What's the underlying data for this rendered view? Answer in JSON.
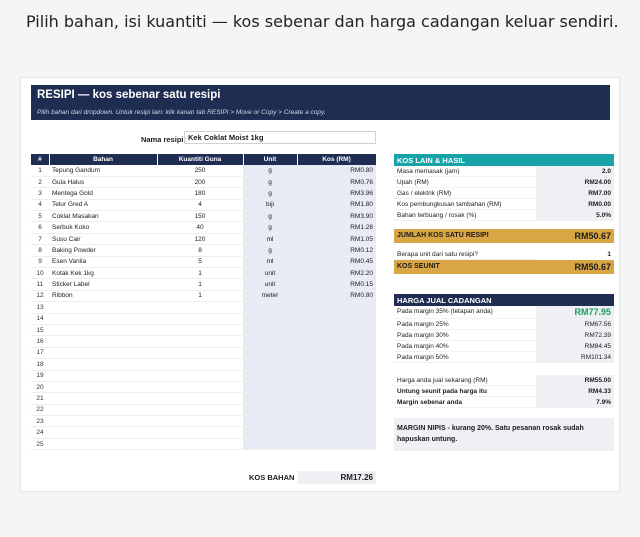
{
  "intro": "Pilih bahan, isi kuantiti — kos sebenar dan harga cadangan keluar sendiri.",
  "banner": {
    "title": "RESIPI — kos sebenar satu resipi",
    "subtitle": "Pilih bahan dari dropdown. Untuk resipi lain: klik kanan tab RESIPI > Move or Copy > Create a copy."
  },
  "recipe": {
    "name_label": "Nama resipi:",
    "name_value": "Kek Coklat Moist 1kg"
  },
  "grid": {
    "headers": [
      "#",
      "Bahan",
      "Kuantiti Guna",
      "Unit",
      "Kos (RM)"
    ],
    "rows": [
      {
        "n": "1",
        "bahan": "Tepung Gandum",
        "q": "250",
        "unit": "g",
        "kos": "RM0.80"
      },
      {
        "n": "2",
        "bahan": "Gula Halus",
        "q": "200",
        "unit": "g",
        "kos": "RM0.76"
      },
      {
        "n": "3",
        "bahan": "Mentega Gold",
        "q": "180",
        "unit": "g",
        "kos": "RM3.96"
      },
      {
        "n": "4",
        "bahan": "Telur Gred A",
        "q": "4",
        "unit": "biji",
        "kos": "RM1.80"
      },
      {
        "n": "5",
        "bahan": "Coklat Masakan",
        "q": "150",
        "unit": "g",
        "kos": "RM3.90"
      },
      {
        "n": "6",
        "bahan": "Serbuk Koko",
        "q": "40",
        "unit": "g",
        "kos": "RM1.28"
      },
      {
        "n": "7",
        "bahan": "Susu Cair",
        "q": "120",
        "unit": "ml",
        "kos": "RM1.05"
      },
      {
        "n": "8",
        "bahan": "Baking Powder",
        "q": "8",
        "unit": "g",
        "kos": "RM0.12"
      },
      {
        "n": "9",
        "bahan": "Esen Vanila",
        "q": "5",
        "unit": "ml",
        "kos": "RM0.45"
      },
      {
        "n": "10",
        "bahan": "Kotak Kek 1kg",
        "q": "1",
        "unit": "unit",
        "kos": "RM2.20"
      },
      {
        "n": "11",
        "bahan": "Sticker Label",
        "q": "1",
        "unit": "unit",
        "kos": "RM0.15"
      },
      {
        "n": "12",
        "bahan": "Ribbon",
        "q": "1",
        "unit": "meter",
        "kos": "RM0.80"
      },
      {
        "n": "13",
        "bahan": "",
        "q": "",
        "unit": "",
        "kos": ""
      },
      {
        "n": "14",
        "bahan": "",
        "q": "",
        "unit": "",
        "kos": ""
      },
      {
        "n": "15",
        "bahan": "",
        "q": "",
        "unit": "",
        "kos": ""
      },
      {
        "n": "16",
        "bahan": "",
        "q": "",
        "unit": "",
        "kos": ""
      },
      {
        "n": "17",
        "bahan": "",
        "q": "",
        "unit": "",
        "kos": ""
      },
      {
        "n": "18",
        "bahan": "",
        "q": "",
        "unit": "",
        "kos": ""
      },
      {
        "n": "19",
        "bahan": "",
        "q": "",
        "unit": "",
        "kos": ""
      },
      {
        "n": "20",
        "bahan": "",
        "q": "",
        "unit": "",
        "kos": ""
      },
      {
        "n": "21",
        "bahan": "",
        "q": "",
        "unit": "",
        "kos": ""
      },
      {
        "n": "22",
        "bahan": "",
        "q": "",
        "unit": "",
        "kos": ""
      },
      {
        "n": "23",
        "bahan": "",
        "q": "",
        "unit": "",
        "kos": ""
      },
      {
        "n": "24",
        "bahan": "",
        "q": "",
        "unit": "",
        "kos": ""
      },
      {
        "n": "25",
        "bahan": "",
        "q": "",
        "unit": "",
        "kos": ""
      }
    ],
    "total_label": "KOS BAHAN",
    "total_value": "RM17.26"
  },
  "kos_lain": {
    "header": "KOS LAIN & HASIL",
    "rows": [
      {
        "label": "Masa memasak (jam)",
        "value": "2.0"
      },
      {
        "label": "Upah (RM)",
        "value": "RM24.00"
      },
      {
        "label": "Gas / elektrik (RM)",
        "value": "RM7.00"
      },
      {
        "label": "Kos pembungkusan tambahan (RM)",
        "value": "RM0.00"
      },
      {
        "label": "Bahan terbuang / rosak (%)",
        "value": "5.0%"
      }
    ],
    "jumlah_label": "JUMLAH KOS SATU RESIPI",
    "jumlah_value": "RM50.67",
    "berapa_label": "Berapa unit dari satu resipi?",
    "berapa_value": "1",
    "seunit_label": "KOS SEUNIT",
    "seunit_value": "RM50.67"
  },
  "harga": {
    "header": "HARGA JUAL CADANGAN",
    "main_label": "Pada margin 35% (tetapan anda)",
    "main_value": "RM77.95",
    "rows": [
      {
        "label": "Pada margin 25%",
        "value": "RM67.56"
      },
      {
        "label": "Pada margin 30%",
        "value": "RM72.39"
      },
      {
        "label": "Pada margin 40%",
        "value": "RM84.45"
      },
      {
        "label": "Pada margin 50%",
        "value": "RM101.34"
      }
    ],
    "current_rows": [
      {
        "label": "Harga anda jual sekarang (RM)",
        "value": "RM55.00"
      },
      {
        "label": "Untung seunit pada harga itu",
        "value": "RM4.33"
      },
      {
        "label": "Margin sebenar anda",
        "value": "7.9%"
      }
    ]
  },
  "note": "MARGIN NIPIS - kurang 20%. Satu pesanan rosak sudah hapuskan untung.",
  "colors": {
    "navy": "#1f2d52",
    "teal": "#17a3a8",
    "gold": "#d9a645",
    "green": "#1e9e5a",
    "cell": "#e8ebf3"
  }
}
